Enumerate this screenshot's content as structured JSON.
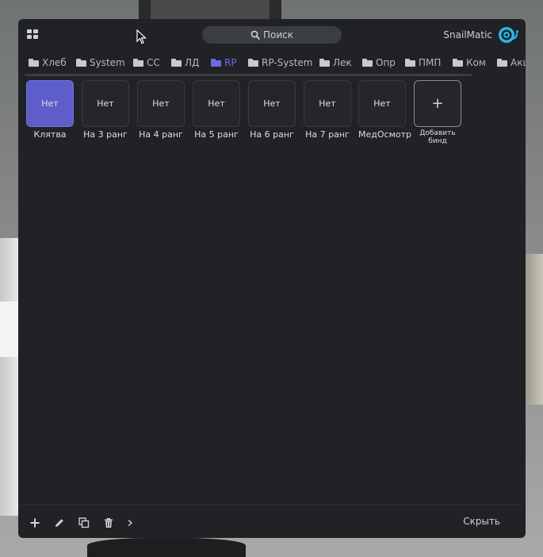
{
  "header": {
    "search_label": "Поиск",
    "brand_name": "SnailMatic",
    "brand_logo_icon": "snail-logo-icon",
    "accent_color": "#5e5ecb"
  },
  "tabs": [
    {
      "label": "Хлеб",
      "active": false
    },
    {
      "label": "System",
      "active": false
    },
    {
      "label": "CC",
      "active": false
    },
    {
      "label": "ЛД",
      "active": false
    },
    {
      "label": "RP",
      "active": true
    },
    {
      "label": "RP-System",
      "active": false
    },
    {
      "label": "Лек",
      "active": false
    },
    {
      "label": "Опр",
      "active": false
    },
    {
      "label": "ПМП",
      "active": false
    },
    {
      "label": "Ком",
      "active": false
    },
    {
      "label": "Акц",
      "active": false
    }
  ],
  "binds": [
    {
      "key": "Нет",
      "name": "Клятва",
      "active": true
    },
    {
      "key": "Нет",
      "name": "На 3 ранг",
      "active": false
    },
    {
      "key": "Нет",
      "name": "На 4 ранг",
      "active": false
    },
    {
      "key": "Нет",
      "name": "На 5 ранг",
      "active": false
    },
    {
      "key": "Нет",
      "name": "На 6 ранг",
      "active": false
    },
    {
      "key": "Нет",
      "name": "На 7 ранг",
      "active": false
    },
    {
      "key": "Нет",
      "name": "МедОсмотр",
      "active": false
    }
  ],
  "add_bind": {
    "symbol": "+",
    "label": "Добавить бинд"
  },
  "footer": {
    "icons": [
      "plus-icon",
      "pencil-icon",
      "copy-icon",
      "trash-icon",
      "chevron-right-icon"
    ],
    "hide_label": "Скрыть"
  }
}
